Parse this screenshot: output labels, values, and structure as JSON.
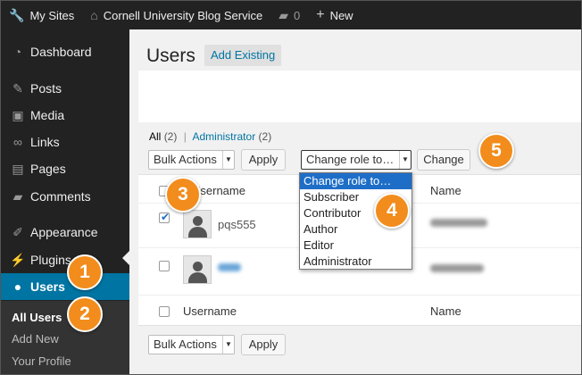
{
  "adminbar": {
    "my_sites": "My Sites",
    "site_name": "Cornell University Blog Service",
    "comments_count": "0",
    "new_label": "New"
  },
  "sidebar": {
    "items": [
      {
        "label": "Dashboard",
        "icon": "dashboard-icon"
      },
      {
        "label": "Posts",
        "icon": "pin-icon"
      },
      {
        "label": "Media",
        "icon": "media-icon"
      },
      {
        "label": "Links",
        "icon": "link-icon"
      },
      {
        "label": "Pages",
        "icon": "pages-icon"
      },
      {
        "label": "Comments",
        "icon": "comment-icon"
      },
      {
        "label": "Appearance",
        "icon": "brush-icon"
      },
      {
        "label": "Plugins",
        "icon": "plug-icon"
      },
      {
        "label": "Users",
        "icon": "user-icon"
      }
    ],
    "submenu": [
      "All Users",
      "Add New",
      "Your Profile"
    ]
  },
  "main": {
    "title": "Users",
    "add_existing": "Add Existing",
    "views": {
      "all_label": "All",
      "all_count": "(2)",
      "separator": "|",
      "admin_label": "Administrator",
      "admin_count": "(2)"
    },
    "bulk_actions": "Bulk Actions",
    "apply": "Apply",
    "change_role_select": "Change role to…",
    "change": "Change",
    "table": {
      "col_username": "Username",
      "col_name": "Name",
      "rows": [
        {
          "username": "pqs555",
          "checked": true
        },
        {
          "username": "",
          "checked": false
        }
      ]
    }
  },
  "dropdown": {
    "options": [
      "Change role to…",
      "Subscriber",
      "Contributor",
      "Author",
      "Editor",
      "Administrator"
    ],
    "selected_index": 0
  },
  "callouts": [
    "1",
    "2",
    "3",
    "4",
    "5"
  ],
  "colors": {
    "accent": "#0074a2",
    "callout": "#f28c1c",
    "adminbar": "#222222"
  }
}
